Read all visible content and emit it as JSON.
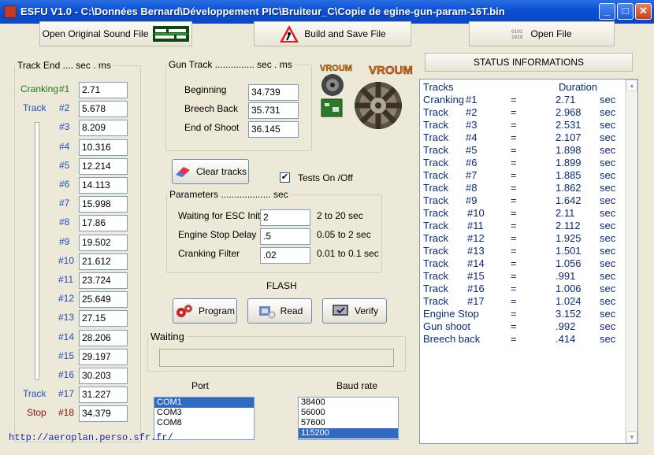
{
  "window": {
    "title": "ESFU V1.0  -  C:\\Données Bernard\\Développement PIC\\Bruiteur_C\\Copie de egine-gun-param-16T.bin"
  },
  "toolbar": {
    "open_original": "Open Original  Sound File",
    "build_save": "Build and Save  File",
    "open_file": "Open  File"
  },
  "track_end": {
    "legend": "Track End  ....  sec . ms",
    "rows": [
      {
        "name": "Cranking",
        "num": "#1",
        "value": "2.71"
      },
      {
        "name": "Track",
        "num": "#2",
        "value": "5.678"
      },
      {
        "name": "",
        "num": "#3",
        "value": "8.209"
      },
      {
        "name": "",
        "num": "#4",
        "value": "10.316"
      },
      {
        "name": "",
        "num": "#5",
        "value": "12.214"
      },
      {
        "name": "",
        "num": "#6",
        "value": "14.113"
      },
      {
        "name": "",
        "num": "#7",
        "value": "15.998"
      },
      {
        "name": "",
        "num": "#8",
        "value": "17.86"
      },
      {
        "name": "",
        "num": "#9",
        "value": "19.502"
      },
      {
        "name": "",
        "num": "#10",
        "value": "21.612"
      },
      {
        "name": "",
        "num": "#11",
        "value": "23.724"
      },
      {
        "name": "",
        "num": "#12",
        "value": "25.649"
      },
      {
        "name": "",
        "num": "#13",
        "value": "27.15"
      },
      {
        "name": "",
        "num": "#14",
        "value": "28.206"
      },
      {
        "name": "",
        "num": "#15",
        "value": "29.197"
      },
      {
        "name": "",
        "num": "#16",
        "value": "30.203"
      },
      {
        "name": "Track",
        "num": "#17",
        "value": "31.227"
      },
      {
        "name": "Stop",
        "num": "#18",
        "value": "34.379"
      }
    ]
  },
  "gun_track": {
    "legend": "Gun Track  ...............  sec . ms",
    "beginning_label": "Beginning",
    "beginning_value": "34.739",
    "breech_label": "Breech Back",
    "breech_value": "35.731",
    "end_label": "End of Shoot",
    "end_value": "36.145"
  },
  "logo": {
    "text1": "VROUM",
    "text2": "VROUM"
  },
  "clear_tracks": "Clear tracks",
  "tests_label": "Tests  On /Off",
  "tests_checked": true,
  "parameters": {
    "legend": "Parameters  ...................    sec",
    "esc_label": "Waiting for ESC Init",
    "esc_value": "2",
    "esc_range": "2 to 20 sec",
    "engine_label": "Engine Stop Delay",
    "engine_value": ".5",
    "engine_range": "0.05 to 2 sec",
    "crank_label": "Cranking Filter",
    "crank_value": ".02",
    "crank_range": "0.01 to 0.1 sec"
  },
  "flash": {
    "label": "FLASH",
    "program": "Program",
    "read": "Read",
    "verify": "Verify"
  },
  "waiting": {
    "legend": "Waiting",
    "progress": 0
  },
  "port": {
    "label": "Port",
    "options": [
      "COM1",
      "COM3",
      "COM8"
    ],
    "selected": "COM1"
  },
  "baud": {
    "label": "Baud rate",
    "options": [
      "38400",
      "56000",
      "57600",
      "115200"
    ],
    "selected": "115200"
  },
  "status": {
    "button": "STATUS INFORMATIONS",
    "header_left": "Tracks",
    "header_right": "Duration",
    "rows": [
      {
        "name": "Cranking",
        "num": "#1",
        "eq": "=",
        "value": "2.71",
        "unit": "sec"
      },
      {
        "name": "Track",
        "num": "#2",
        "eq": "=",
        "value": "2.968",
        "unit": "sec"
      },
      {
        "name": "Track",
        "num": "#3",
        "eq": "=",
        "value": "2.531",
        "unit": "sec"
      },
      {
        "name": "Track",
        "num": "#4",
        "eq": "=",
        "value": "2.107",
        "unit": "sec"
      },
      {
        "name": "Track",
        "num": "#5",
        "eq": "=",
        "value": "1.898",
        "unit": "sec"
      },
      {
        "name": "Track",
        "num": "#6",
        "eq": "=",
        "value": "1.899",
        "unit": "sec"
      },
      {
        "name": "Track",
        "num": "#7",
        "eq": "=",
        "value": "1.885",
        "unit": "sec"
      },
      {
        "name": "Track",
        "num": "#8",
        "eq": "=",
        "value": "1.862",
        "unit": "sec"
      },
      {
        "name": "Track",
        "num": "#9",
        "eq": "=",
        "value": "1.642",
        "unit": "sec"
      },
      {
        "name": "Track",
        "num": "#10",
        "eq": "=",
        "value": "2.11",
        "unit": "sec"
      },
      {
        "name": "Track",
        "num": "#11",
        "eq": "=",
        "value": "2.112",
        "unit": "sec"
      },
      {
        "name": "Track",
        "num": "#12",
        "eq": "=",
        "value": "1.925",
        "unit": "sec"
      },
      {
        "name": "Track",
        "num": "#13",
        "eq": "=",
        "value": "1.501",
        "unit": "sec"
      },
      {
        "name": "Track",
        "num": "#14",
        "eq": "=",
        "value": "1.056",
        "unit": "sec"
      },
      {
        "name": "Track",
        "num": "#15",
        "eq": "=",
        "value": ".991",
        "unit": "sec"
      },
      {
        "name": "Track",
        "num": "#16",
        "eq": "=",
        "value": "1.006",
        "unit": "sec"
      },
      {
        "name": "Track",
        "num": "#17",
        "eq": "=",
        "value": "1.024",
        "unit": "sec"
      },
      {
        "name": "Engine Stop",
        "num": "",
        "eq": "=",
        "value": "3.152",
        "unit": "sec"
      },
      {
        "name": "Gun shoot",
        "num": "",
        "eq": "=",
        "value": ".992",
        "unit": "sec"
      },
      {
        "name": "Breech back",
        "num": "",
        "eq": "=",
        "value": ".414",
        "unit": "sec"
      }
    ]
  },
  "footer_link": "http://aeroplan.perso.sfr.fr/",
  "colors": {
    "cranking": "#1a7a1a",
    "track": "#2050c0",
    "stop": "#8a1010",
    "status_text": "#0a2a78",
    "link": "#1a2aa0"
  }
}
